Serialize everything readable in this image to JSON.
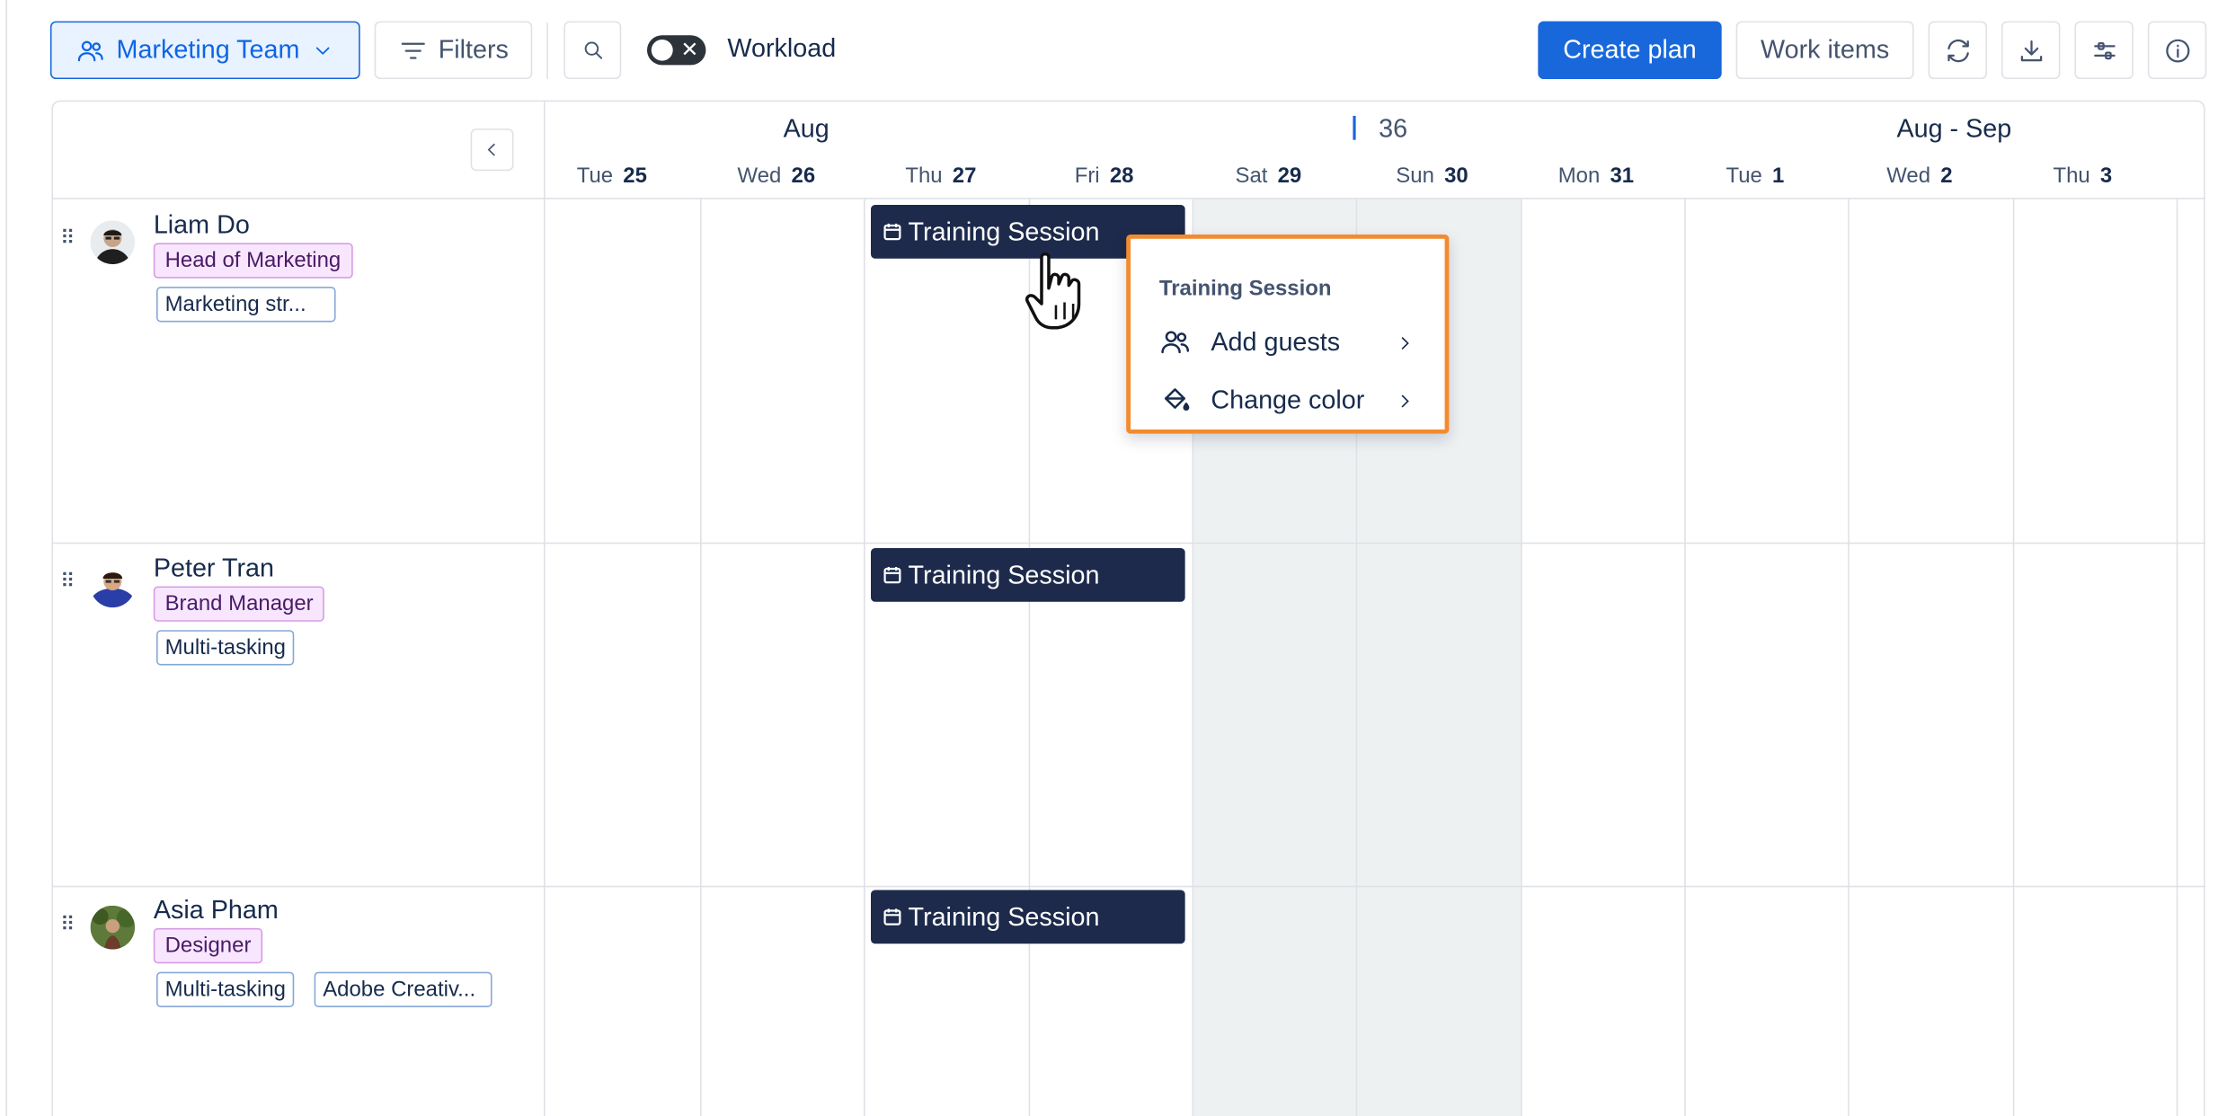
{
  "toolbar": {
    "team_label": "Marketing Team",
    "filters_label": "Filters",
    "workload_label": "Workload",
    "create_plan_label": "Create plan",
    "work_items_label": "Work items"
  },
  "timeline": {
    "months": [
      "Aug",
      "Aug - Sep"
    ],
    "week_number": "36",
    "days": [
      {
        "dow": "Tue",
        "date": "25"
      },
      {
        "dow": "Wed",
        "date": "26"
      },
      {
        "dow": "Thu",
        "date": "27"
      },
      {
        "dow": "Fri",
        "date": "28"
      },
      {
        "dow": "Sat",
        "date": "29"
      },
      {
        "dow": "Sun",
        "date": "30"
      },
      {
        "dow": "Mon",
        "date": "31"
      },
      {
        "dow": "Tue",
        "date": "1"
      },
      {
        "dow": "Wed",
        "date": "2"
      },
      {
        "dow": "Thu",
        "date": "3"
      }
    ]
  },
  "people": [
    {
      "name": "Liam Do",
      "role": "Head of Marketing",
      "tags": [
        "Marketing str..."
      ],
      "event": "Training Session"
    },
    {
      "name": "Peter Tran",
      "role": "Brand Manager",
      "tags": [
        "Multi-tasking"
      ],
      "event": "Training Session"
    },
    {
      "name": "Asia Pham",
      "role": "Designer",
      "tags": [
        "Multi-tasking",
        "Adobe Creativ..."
      ],
      "event": "Training Session"
    }
  ],
  "context_menu": {
    "title": "Training Session",
    "items": [
      {
        "label": "Add guests",
        "icon": "people-icon"
      },
      {
        "label": "Change color",
        "icon": "paint-bucket-icon"
      }
    ]
  },
  "colors": {
    "primary": "#1868db",
    "event_bg": "#1d2a4b",
    "highlight": "#f38b2e",
    "role_bg": "#f8e6ff",
    "weekend_bg": "#eef1f2"
  }
}
